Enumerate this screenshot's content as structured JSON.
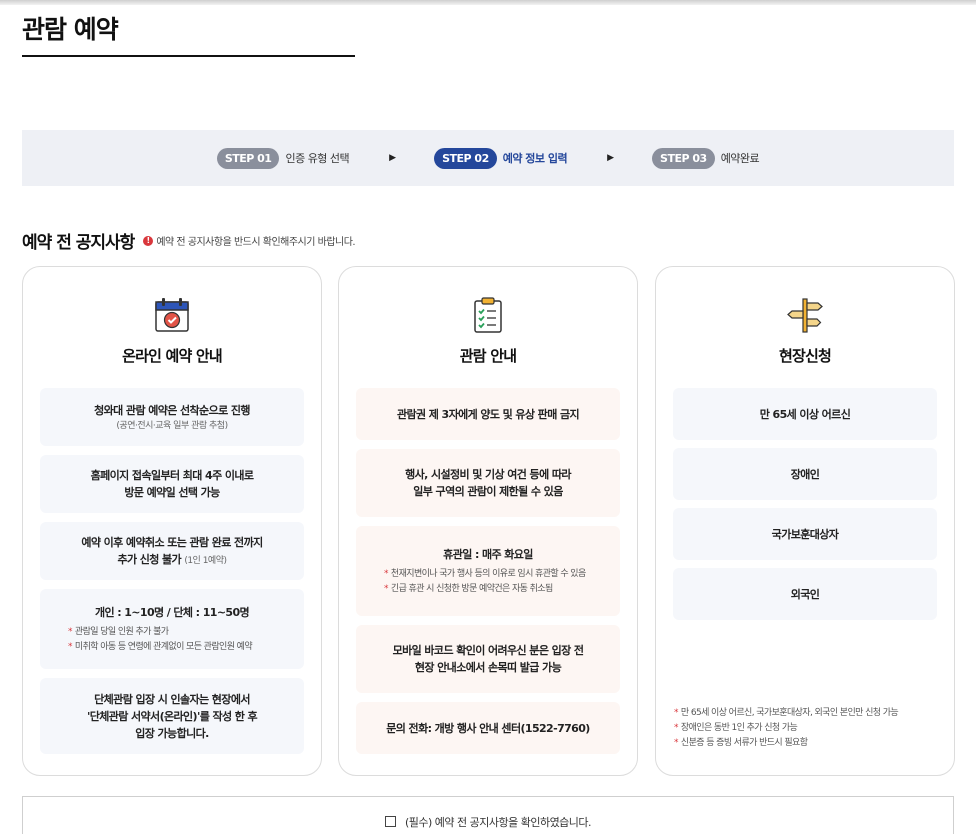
{
  "page": {
    "title": "관람 예약"
  },
  "steps": [
    {
      "badge": "STEP 01",
      "label": "인증 유형 선택",
      "active": false
    },
    {
      "badge": "STEP 02",
      "label": "예약 정보 입력",
      "active": true
    },
    {
      "badge": "STEP 03",
      "label": "예약완료",
      "active": false
    }
  ],
  "step_arrow": "▶",
  "notice": {
    "title": "예약 전 공지사항",
    "alert_glyph": "!",
    "subtitle": "예약 전 공지사항을 반드시 확인해주시기 바랍니다."
  },
  "cards": [
    {
      "title": "온라인 예약 안내",
      "icon": "calendar-check-icon",
      "boxes": [
        {
          "main": "청와대 관람 예약은 선착순으로 진행",
          "small": "(공연·전시·교육 일부 관람 추첨)"
        },
        {
          "line1": "홈페이지 접속일부터 최대 4주 이내로",
          "line2": "방문 예약일 선택 가능"
        },
        {
          "line1": "예약 이후 예약취소 또는 관람 완료 전까지",
          "line2": "추가 신청 불가",
          "small": "(1인 1예약)"
        },
        {
          "main": "개인 : 1~10명 / 단체 : 11~50명",
          "notes": [
            "관람일 당일 인원 추가 불가",
            "미취학 아동 등 연령에 관계없이 모든 관람인원 예약"
          ]
        },
        {
          "line1": "단체관람 입장 시 인솔자는 현장에서",
          "line2": "'단체관람 서약서(온라인)'를 작성 한 후",
          "line3": "입장 가능합니다."
        }
      ]
    },
    {
      "title": "관람 안내",
      "icon": "clipboard-checklist-icon",
      "boxes": [
        {
          "main": "관람권 제 3자에게 양도 및 유상 판매 금지"
        },
        {
          "line1": "행사, 시설정비 및 기상 여건 등에 따라",
          "line2": "일부 구역의 관람이 제한될 수 있음"
        },
        {
          "main": "휴관일 : 매주 화요일",
          "notes": [
            "천재지변이나 국가 행사 등의 이유로 임시 휴관할 수 있음",
            "긴급 휴관 시 신청한 방문 예약건은 자동 취소됨"
          ]
        },
        {
          "line1": "모바일 바코드 확인이 어려우신 분은 입장 전",
          "line2": "현장 안내소에서 손목띠 발급 가능"
        },
        {
          "main": "문의 전화: 개방 행사 안내 센터(1522-7760)"
        }
      ]
    },
    {
      "title": "현장신청",
      "icon": "signpost-icon",
      "boxes": [
        {
          "main": "만 65세 이상 어르신"
        },
        {
          "main": "장애인"
        },
        {
          "main": "국가보훈대상자"
        },
        {
          "main": "외국인"
        }
      ],
      "notes": [
        "만 65세 이상 어르신, 국가보훈대상자, 외국인 본인만 신청 가능",
        "장애인은 동반 1인 추가 신청 가능",
        "신분증 등 증빙 서류가 반드시 필요함"
      ]
    }
  ],
  "agree": {
    "label": "(필수) 예약 전 공지사항을 확인하였습니다."
  },
  "colors": {
    "accent": "#24479b",
    "step_inactive": "#8a8f9c",
    "alert": "#d9373c",
    "box_blue": "#f5f7fb",
    "box_warm": "#fdf6f3"
  }
}
